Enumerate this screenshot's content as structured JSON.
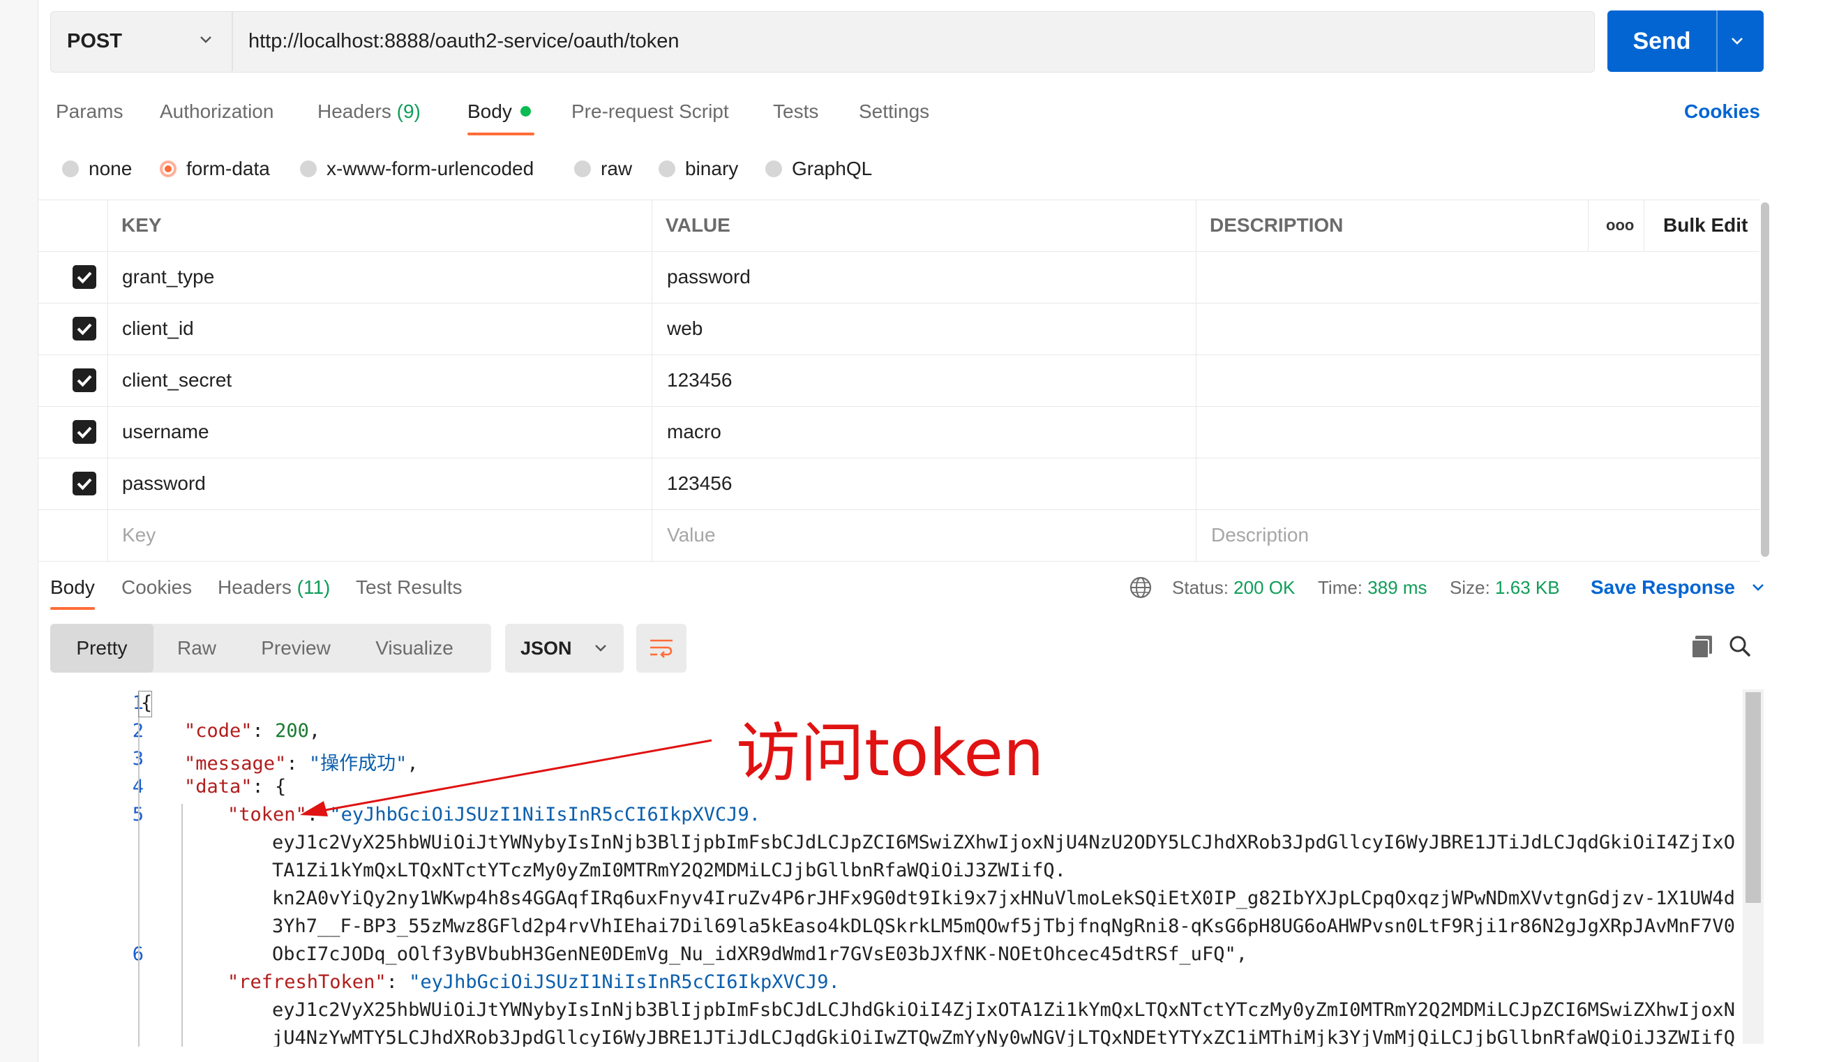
{
  "request": {
    "method": "POST",
    "url": "http://localhost:8888/oauth2-service/oauth/token",
    "send_label": "Send"
  },
  "tabs": {
    "params": "Params",
    "authorization": "Authorization",
    "headers_label": "Headers",
    "headers_count": "(9)",
    "body": "Body",
    "prerequest": "Pre-request Script",
    "tests": "Tests",
    "settings": "Settings",
    "cookies": "Cookies"
  },
  "body_types": [
    "none",
    "form-data",
    "x-www-form-urlencoded",
    "raw",
    "binary",
    "GraphQL"
  ],
  "body_type_selected": "form-data",
  "form_table": {
    "headers": {
      "key": "KEY",
      "value": "VALUE",
      "description": "DESCRIPTION",
      "more": "ooo",
      "bulk_edit": "Bulk Edit"
    },
    "rows": [
      {
        "key": "grant_type",
        "value": "password",
        "checked": true
      },
      {
        "key": "client_id",
        "value": "web",
        "checked": true
      },
      {
        "key": "client_secret",
        "value": "123456",
        "checked": true
      },
      {
        "key": "username",
        "value": "macro",
        "checked": true
      },
      {
        "key": "password",
        "value": "123456",
        "checked": true
      }
    ],
    "placeholders": {
      "key": "Key",
      "value": "Value",
      "description": "Description"
    }
  },
  "response": {
    "tabs": {
      "body": "Body",
      "cookies": "Cookies",
      "headers_label": "Headers",
      "headers_count": "(11)",
      "test_results": "Test Results"
    },
    "status_label": "Status:",
    "status_value": "200 OK",
    "time_label": "Time:",
    "time_value": "389 ms",
    "size_label": "Size:",
    "size_value": "1.63 KB",
    "save_response": "Save Response",
    "formats": [
      "Pretty",
      "Raw",
      "Preview",
      "Visualize"
    ],
    "format_selected": "Pretty",
    "language": "JSON"
  },
  "code": {
    "line_numbers": [
      "1",
      "2",
      "3",
      "4",
      "5",
      "6"
    ],
    "brace_open": "{",
    "code_key": "\"code\"",
    "code_val": "200",
    "message_key": "\"message\"",
    "message_val": "\"操作成功\"",
    "data_key": "\"data\"",
    "token_key": "\"token\"",
    "token_lines": [
      "\"eyJhbGciOiJSUzI1NiIsInR5cCI6IkpXVCJ9.",
      "eyJ1c2VyX25hbWUiOiJtYWNybyIsInNjb3BlIjpbImFsbCJdLCJpZCI6MSwiZXhwIjoxNjU4NzU2ODY5LCJhdXRob3JpdGllcyI6WyJBRE1JTiJdLCJqdGkiOiI4ZjIxO",
      "TA1Zi1kYmQxLTQxNTctYTczMy0yZmI0MTRmY2Q2MDMiLCJjbGllbnRfaWQiOiJ3ZWIifQ.",
      "kn2A0vYiQy2ny1WKwp4h8s4GGAqfIRq6uxFnyv4IruZv4P6rJHFx9G0dt9Iki9x7jxHNuVlmoLekSQiEtX0IP_g82IbYXJpLCpqOxqzjWPwNDmXVvtgnGdjzv-1X1UW4d",
      "3Yh7__F-BP3_55zMwz8GFld2p4rvVhIEhai7Dil69la5kEaso4kDLQSkrkLM5mQOwf5jTbjfnqNgRni8-qKsG6pH8UG6oAHWPvsn0LtF9Rji1r86N2gJgXRpJAvMnF7V0",
      "ObcI7cJODq_oOlf3yBVbubH3GenNE0DEmVg_Nu_idXR9dWmd1r7GVsE03bJXfNK-NOEtOhcec45dtRSf_uFQ\","
    ],
    "refresh_key": "\"refreshToken\"",
    "refresh_lines": [
      "\"eyJhbGciOiJSUzI1NiIsInR5cCI6IkpXVCJ9.",
      "eyJ1c2VyX25hbWUiOiJtYWNybyIsInNjb3BlIjpbImFsbCJdLCJhdGkiOiI4ZjIxOTA1Zi1kYmQxLTQxNTctYTczMy0yZmI0MTRmY2Q2MDMiLCJpZCI6MSwiZXhwIjoxN",
      "jU4NzYwMTY5LCJhdXRob3JpdGllcyI6WyJBRE1JTiJdLCJqdGkiOiIwZTQwZmYyNy0wNGVjLTQxNDEtYTYxZC1iMThiMjk3YjVmMjQiLCJjbGllbnRfaWQiOiJ3ZWIifQ"
    ]
  },
  "annotation": "访问token",
  "colors": {
    "accent_orange": "#ff6c37",
    "send_blue": "#0265d2",
    "link_blue": "#0265d2",
    "success_green": "#0f9d58",
    "annotation_red": "#e01212"
  }
}
